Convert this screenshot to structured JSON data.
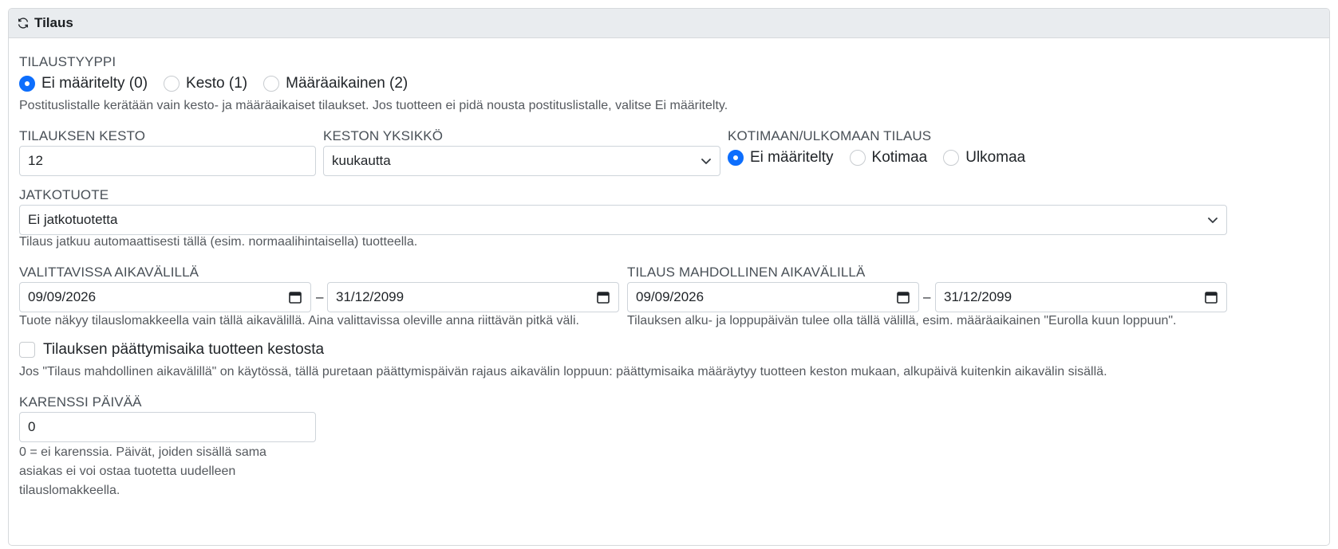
{
  "panel": {
    "title": "Tilaus",
    "icon": "refresh-icon"
  },
  "subscription_type": {
    "label": "TILAUSTYYPPI",
    "options": [
      "Ei määritelty (0)",
      "Kesto (1)",
      "Määräaikainen (2)"
    ],
    "selected_index": 0,
    "help": "Postituslistalle kerätään vain kesto- ja määräaikaiset tilaukset. Jos tuotteen ei pidä nousta postituslistalle, valitse Ei määritelty."
  },
  "duration": {
    "label": "TILAUKSEN KESTO",
    "value": "12"
  },
  "duration_unit": {
    "label": "KESTON YKSIKKÖ",
    "value": "kuukautta"
  },
  "domestic": {
    "label": "KOTIMAAN/ULKOMAAN TILAUS",
    "options": [
      "Ei määritelty",
      "Kotimaa",
      "Ulkomaa"
    ],
    "selected_index": 0
  },
  "continuation": {
    "label": "JATKOTUOTE",
    "value": "Ei jatkotuotetta",
    "help": "Tilaus jatkuu automaattisesti tällä (esim. normaalihintaisella) tuotteella."
  },
  "selectable_period": {
    "label": "VALITTAVISSA AIKAVÄLILLÄ",
    "start": "09/09/2026",
    "end": "31/12/2099",
    "separator": "–",
    "help": "Tuote näkyy tilauslomakkeella vain tällä aikavälillä. Aina valittavissa oleville anna riittävän pitkä väli."
  },
  "allowed_period": {
    "label": "TILAUS MAHDOLLINEN AIKAVÄLILLÄ",
    "start": "09/09/2026",
    "end": "31/12/2099",
    "separator": "–",
    "help": "Tilauksen alku- ja loppupäivän tulee olla tällä välillä, esim. määräaikainen \"Eurolla kuun loppuun\"."
  },
  "end_from_duration": {
    "label": "Tilauksen päättymisaika tuotteen kestosta",
    "checked": false,
    "help": "Jos \"Tilaus mahdollinen aikavälillä\" on käytössä, tällä puretaan päättymispäivän rajaus aikavälin loppuun: päättymisaika määräytyy tuotteen keston mukaan, alkupäivä kuitenkin aikavälin sisällä."
  },
  "quarantine": {
    "label": "KARENSSI PÄIVÄÄ",
    "value": "0",
    "help_lines": [
      "0 = ei karenssia. Päivät, joiden sisällä sama",
      "asiakas ei voi ostaa tuotetta uudelleen",
      "tilauslomakkeella."
    ]
  }
}
